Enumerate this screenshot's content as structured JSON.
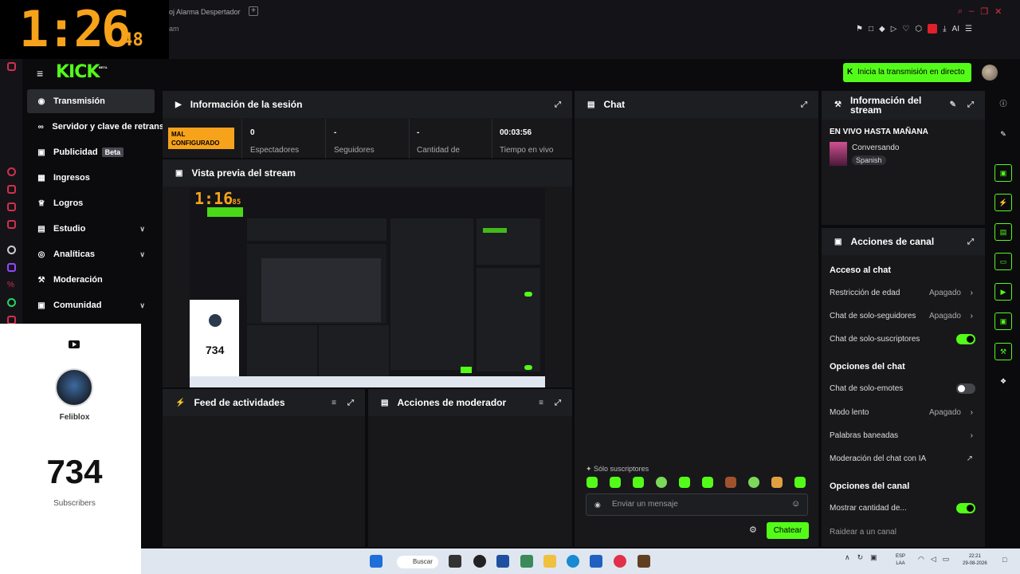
{
  "browser": {
    "tab_title": "oj Alarma Despertador",
    "url_fragment": "am",
    "new_tab_symbol": "+",
    "ai_label": "AI"
  },
  "clock": {
    "main": "1:26",
    "fraction": ".48"
  },
  "kick": {
    "logo": "KICK",
    "logo_badge": "BETA",
    "start_stream": "Inicia la transmisión en directo"
  },
  "sidebar": {
    "items": [
      {
        "label": "Transmisión",
        "icon": "broadcast-icon"
      },
      {
        "label": "Servidor y clave de retrans",
        "icon": "link-icon"
      },
      {
        "label": "Publicidad",
        "icon": "ad-icon",
        "badge": "Beta"
      },
      {
        "label": "Ingresos",
        "icon": "wallet-icon"
      },
      {
        "label": "Logros",
        "icon": "trophy-icon"
      },
      {
        "label": "Estudio",
        "icon": "studio-icon"
      },
      {
        "label": "Analíticas",
        "icon": "analytics-icon"
      },
      {
        "label": "Moderación",
        "icon": "wrench-icon"
      },
      {
        "label": "Comunidad",
        "icon": "community-icon"
      }
    ]
  },
  "session": {
    "title": "Información de la sesión",
    "badge": "MAL CONFIGURADO",
    "stats": [
      {
        "value": "0",
        "label": "Espectadores"
      },
      {
        "value": "-",
        "label": "Seguidores"
      },
      {
        "value": "-",
        "label": "Cantidad de"
      },
      {
        "value": "00:03:56",
        "label": "Tiempo en vivo"
      }
    ]
  },
  "preview": {
    "title": "Vista previa del stream"
  },
  "feed": {
    "title": "Feed de actividades"
  },
  "mod_actions": {
    "title": "Acciones de moderador"
  },
  "chat": {
    "title": "Chat",
    "sub_only": "Sólo suscriptores",
    "placeholder": "Enviar un mensaje",
    "send": "Chatear"
  },
  "stream_info": {
    "title_line1": "Información del",
    "title_line2": "stream",
    "live_until": "EN VIVO HASTA MAÑANA",
    "category": "Conversando",
    "language": "Spanish"
  },
  "channel_actions": {
    "title": "Acciones de canal",
    "chat_access": "Acceso al chat",
    "age_restriction": "Restricción de edad",
    "age_restriction_val": "Apagado",
    "followers_only": "Chat de solo-seguidores",
    "followers_only_val": "Apagado",
    "subs_only": "Chat de solo-suscriptores",
    "chat_options": "Opciones del chat",
    "emotes_only": "Chat de solo-emotes",
    "slow_mode": "Modo lento",
    "slow_mode_val": "Apagado",
    "banned_words": "Palabras baneadas",
    "ai_moderation": "Moderación del chat con IA",
    "channel_options": "Opciones del canal",
    "show_count": "Mostrar cantidad de...",
    "raid": "Raidear a un canal"
  },
  "overlay": {
    "name": "Feliblox",
    "count": "734",
    "label": "Subscribers"
  },
  "taskbar": {
    "search": "Buscar",
    "lang1": "ESP",
    "lang2": "LAA",
    "time": "22:21",
    "date": "29-08-2026"
  },
  "colors": {
    "accent": "#53fc18",
    "warning": "#f7a21b",
    "panel": "#18181b"
  }
}
